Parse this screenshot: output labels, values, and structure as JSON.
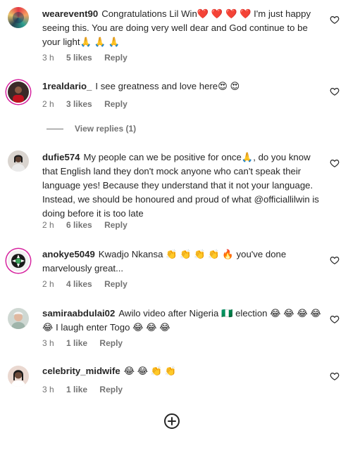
{
  "comments": [
    {
      "username": "wearevent90",
      "text": "Congratulations Lil Win❤️ ❤️ ❤️ ❤️  I'm just happy seeing this. You are doing very well dear and God continue to be your light🙏 🙏 🙏",
      "time": "3 h",
      "likes": "5 likes",
      "reply": "Reply"
    },
    {
      "username": "1realdario_",
      "text": "I see greatness and love here😍 😍",
      "time": "2 h",
      "likes": "3 likes",
      "reply": "Reply"
    },
    {
      "username": "dufie574",
      "text": "My people can we be positive for once🙏, do you know that English land they don't mock anyone who can't speak their language yes! Because they understand that it not your language. Instead, we should be honoured and proud of what @officiallilwin is doing before it is too late",
      "time": "2 h",
      "likes": "6 likes",
      "reply": "Reply"
    },
    {
      "username": "anokye5049",
      "text": "Kwadjo Nkansa 👏 👏 👏 👏 🔥  you've done marvelously great...",
      "time": "2 h",
      "likes": "4 likes",
      "reply": "Reply"
    },
    {
      "username": "samiraabdulai02",
      "text": "Awilo video after Nigeria 🇳🇬 election 😂 😂 😂 😂 😂 I laugh enter Togo 😂 😂 😂",
      "time": "3 h",
      "likes": "1 like",
      "reply": "Reply"
    },
    {
      "username": "celebrity_midwife",
      "text": "😂 😂 👏 👏",
      "time": "3 h",
      "likes": "1 like",
      "reply": "Reply"
    }
  ],
  "view_replies": "View replies (1)",
  "icons": {
    "like": "heart-outline-icon",
    "load_more": "plus-circle-icon"
  },
  "colors": {
    "text": "#262626",
    "secondary": "#737373",
    "story_ring": "#d6249f"
  }
}
